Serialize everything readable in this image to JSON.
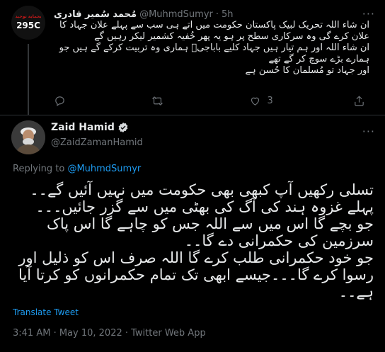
{
  "parent_tweet": {
    "avatar_line1": "بحماية توحيد",
    "avatar_line2": "295C",
    "display_name": "مُحمد سُمیر قادری",
    "handle": "@MuhmdSumyr",
    "separator": "·",
    "time": "5h",
    "text": "ان شاء اللہ تحریک لبیک پاکستان حکومت میں اتے ہی سب سے پہلے علان جہاد کا علان کرے گی وہ سرکاری سطح پر ہو یہ پھر خُفیہ کشمیر لیکر رہیں گے\nان شاء اللہ اور ہم تیار ہیں جہاد کلیے باباجیؒ ہماری وہ تربیت کرکے گے ہیں جو ہمارے بڑے سوچ کر گے تھے\nاور جہاد تو مُسلمان کا حُسن ہے",
    "reply_count": "",
    "retweet_count": "",
    "like_count": "3"
  },
  "main_tweet": {
    "display_name": "Zaid Hamid",
    "handle": "@ZaidZamanHamid",
    "replying_prefix": "Replying to ",
    "replying_to": "@MuhmdSumyr",
    "text": "تسلی رکھیں آپ کبھی بھی حکومت میں نہیں آئیں گے۔۔\nپہلے غزوہ ہند کی آگ کی بھٹی میں سے گزر جائیں۔۔۔\nجو بچے گا اس میں سے اللہ جس کو چاہے گا اس پاک سرزمین کی حکمرانی دے گا۔۔\nجو خود حکمرانی طلب کرے گا اللہ صرف اس کو ذلیل اور رسوا کرے گا۔۔۔جیسے ابھی تک تمام حکمرانوں کو کرتا آیا ہے۔۔",
    "translate_label": "Translate Tweet",
    "timestamp": "3:41 AM · May 10, 2022 · Twitter Web App"
  },
  "colors": {
    "background": "#000000",
    "text": "#e7e9ea",
    "muted": "#71767b",
    "accent": "#1d9bf0",
    "divider": "#2f3336"
  },
  "icons": [
    "more-icon",
    "reply-icon",
    "retweet-icon",
    "like-icon",
    "share-icon",
    "verified-icon"
  ]
}
